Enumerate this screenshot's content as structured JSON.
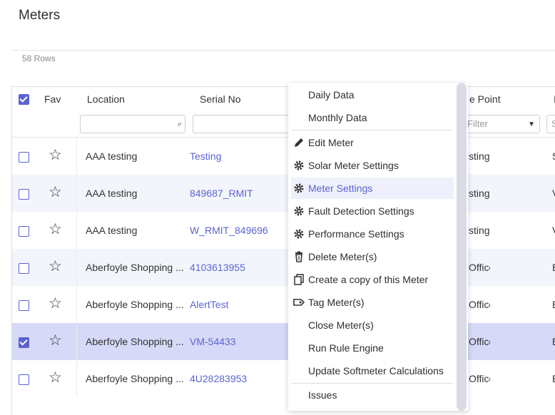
{
  "page": {
    "title": "Meters",
    "row_count": "58 Rows"
  },
  "header": {
    "fav": "Fav",
    "location": "Location",
    "serial_no": "Serial No",
    "clipped_col": "e Point",
    "clipped_col2": "I"
  },
  "filters": {
    "clipped_filter_placeholder": "Filter",
    "clipped_filter2_value": "S"
  },
  "rows": [
    {
      "location": "AAA testing",
      "serial": "Testing",
      "col_a": "sting",
      "col_b": "S",
      "checked": false
    },
    {
      "location": "AAA testing",
      "serial": "849687_RMIT",
      "col_a": "sting",
      "col_b": "V",
      "checked": false
    },
    {
      "location": "AAA testing",
      "serial": "W_RMIT_849696",
      "col_a": "sting",
      "col_b": "V",
      "checked": false
    },
    {
      "location": "Aberfoyle Shopping ...",
      "serial": "4103613955",
      "col_a": "Office",
      "col_b": "E",
      "checked": false
    },
    {
      "location": "Aberfoyle Shopping ...",
      "serial": "AlertTest",
      "col_a": "Office",
      "col_b": "E",
      "checked": false
    },
    {
      "location": "Aberfoyle Shopping ...",
      "serial": "VM-54433",
      "col_a": "Office",
      "col_b": "E",
      "checked": true
    },
    {
      "location": "Aberfoyle Shopping ...",
      "serial": "4U28283953",
      "col_a": "Office",
      "col_b": "E",
      "checked": false
    }
  ],
  "context_menu": {
    "items": [
      {
        "label": "Daily Data",
        "icon": ""
      },
      {
        "label": "Monthly Data",
        "icon": ""
      },
      {
        "label": "Edit Meter",
        "icon": "pencil-icon"
      },
      {
        "label": "Solar Meter Settings",
        "icon": "gear-icon"
      },
      {
        "label": "Meter Settings",
        "icon": "gear-icon",
        "active": true
      },
      {
        "label": "Fault Detection Settings",
        "icon": "gear-icon"
      },
      {
        "label": "Performance Settings",
        "icon": "gear-icon"
      },
      {
        "label": "Delete Meter(s)",
        "icon": "trash-icon"
      },
      {
        "label": "Create a copy of this Meter",
        "icon": "copy-icon"
      },
      {
        "label": "Tag Meter(s)",
        "icon": "tag-icon"
      },
      {
        "label": "Close Meter(s)",
        "icon": ""
      },
      {
        "label": "Run Rule Engine",
        "icon": ""
      },
      {
        "label": "Update Softmeter Calculations",
        "icon": ""
      },
      {
        "label": "Issues",
        "icon": ""
      }
    ]
  },
  "colors": {
    "accent": "#5b63d6",
    "selected_row": "#d6d9f7",
    "alt_row": "#f3f5fc"
  }
}
